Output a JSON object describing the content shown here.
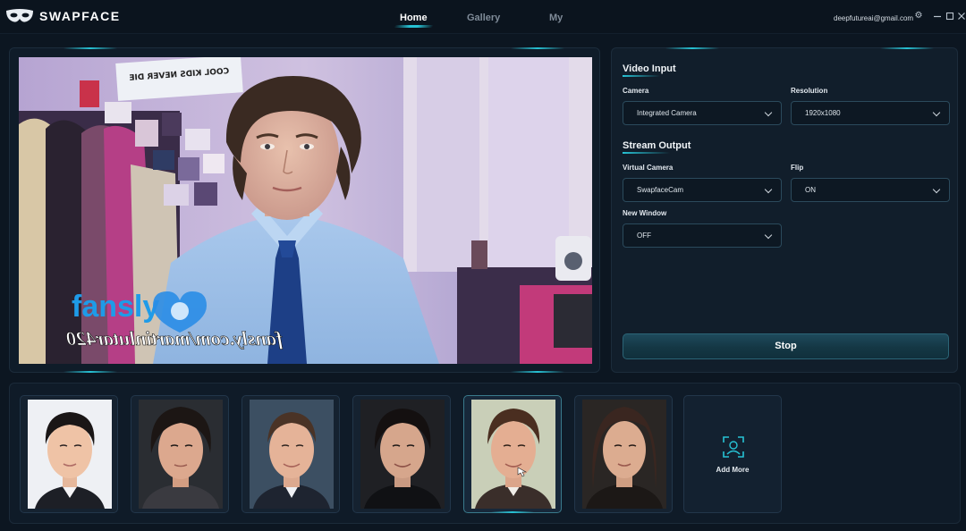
{
  "app": {
    "title": "SWAPFACE",
    "logo_icon": "mask-icon"
  },
  "nav": {
    "tabs": [
      {
        "label": "Home",
        "active": true
      },
      {
        "label": "Gallery",
        "active": false
      },
      {
        "label": "My",
        "active": false
      }
    ]
  },
  "user": {
    "email": "deepfutureai@gmail.com"
  },
  "window_controls": [
    "gear-icon",
    "minimize-icon",
    "maximize-icon",
    "close-icon"
  ],
  "video": {
    "overlay_brand": "fansly",
    "overlay_url": "fansly.com/martinlutar420",
    "poster_text": "COOL KIDS NEVER DIE"
  },
  "settings": {
    "video_input": {
      "title": "Video Input",
      "camera": {
        "label": "Camera",
        "value": "Integrated Camera"
      },
      "resolution": {
        "label": "Resolution",
        "value": "1920x1080"
      }
    },
    "stream_output": {
      "title": "Stream Output",
      "virtual_camera": {
        "label": "Virtual Camera",
        "value": "SwapfaceCam"
      },
      "flip": {
        "label": "Flip",
        "value": "ON"
      },
      "new_window": {
        "label": "New Window",
        "value": "OFF"
      }
    },
    "stop_label": "Stop"
  },
  "faces": {
    "selected_index": 4,
    "add_more_label": "Add More",
    "add_more_icon": "face-scan-icon"
  },
  "colors": {
    "accent": "#27c2d4",
    "background": "#0c1621",
    "panel": "#111e2b"
  }
}
